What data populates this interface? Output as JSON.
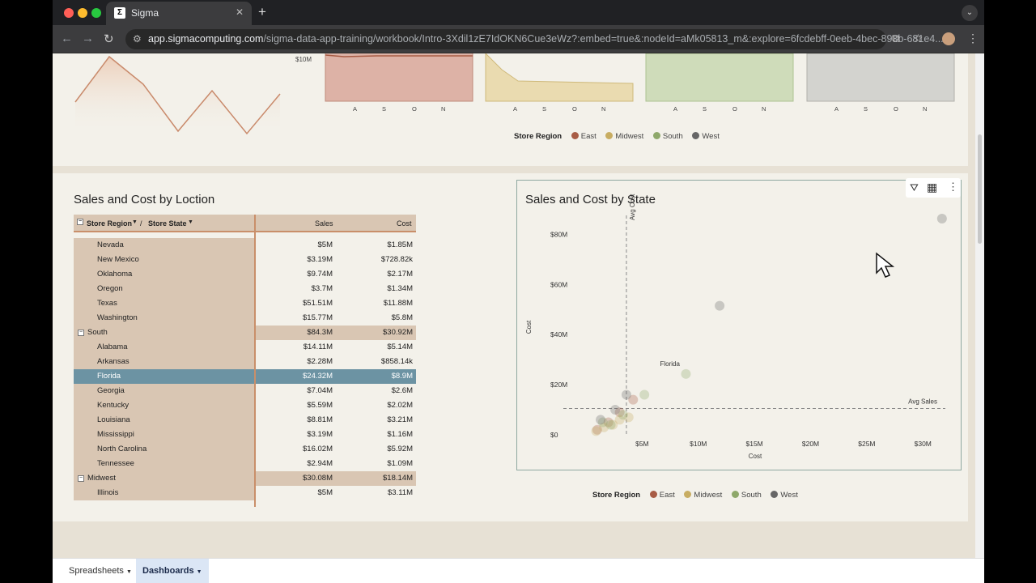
{
  "browser": {
    "tab_title": "Sigma",
    "tab_favicon": "sigma-logo",
    "url_host": "app.sigmacomputing.com",
    "url_path": "/sigma-data-app-training/workbook/Intro-3Xdil1zE7IdOKN6Cue3eWz?:embed=true&:nodeId=aMk05813_m&:explore=6fcdebff-0eeb-4bec-893b-681e4..."
  },
  "top_charts": {
    "axis_top_label": "$10M",
    "month_ticks": [
      "A",
      "S",
      "O",
      "N"
    ],
    "legend_title": "Store Region",
    "legend": [
      {
        "name": "East",
        "color": "#a85c45"
      },
      {
        "name": "Midwest",
        "color": "#c8ad62"
      },
      {
        "name": "South",
        "color": "#8ea86a"
      },
      {
        "name": "West",
        "color": "#666666"
      }
    ]
  },
  "table": {
    "title": "Sales and Cost by Loction",
    "head_region": "Store Region",
    "head_sep": "/",
    "head_state": "Store State",
    "head_sales": "Sales",
    "head_cost": "Cost",
    "rows": [
      {
        "label": "Nevada",
        "sales": "$5M",
        "cost": "$1.85M",
        "kind": "item"
      },
      {
        "label": "New Mexico",
        "sales": "$3.19M",
        "cost": "$728.82k",
        "kind": "item"
      },
      {
        "label": "Oklahoma",
        "sales": "$9.74M",
        "cost": "$2.17M",
        "kind": "item"
      },
      {
        "label": "Oregon",
        "sales": "$3.7M",
        "cost": "$1.34M",
        "kind": "item"
      },
      {
        "label": "Texas",
        "sales": "$51.51M",
        "cost": "$11.88M",
        "kind": "item"
      },
      {
        "label": "Washington",
        "sales": "$15.77M",
        "cost": "$5.8M",
        "kind": "item"
      },
      {
        "label": "South",
        "sales": "$84.3M",
        "cost": "$30.92M",
        "kind": "group"
      },
      {
        "label": "Alabama",
        "sales": "$14.11M",
        "cost": "$5.14M",
        "kind": "item"
      },
      {
        "label": "Arkansas",
        "sales": "$2.28M",
        "cost": "$858.14k",
        "kind": "item"
      },
      {
        "label": "Florida",
        "sales": "$24.32M",
        "cost": "$8.9M",
        "kind": "selected"
      },
      {
        "label": "Georgia",
        "sales": "$7.04M",
        "cost": "$2.6M",
        "kind": "item"
      },
      {
        "label": "Kentucky",
        "sales": "$5.59M",
        "cost": "$2.02M",
        "kind": "item"
      },
      {
        "label": "Louisiana",
        "sales": "$8.81M",
        "cost": "$3.21M",
        "kind": "item"
      },
      {
        "label": "Mississippi",
        "sales": "$3.19M",
        "cost": "$1.16M",
        "kind": "item"
      },
      {
        "label": "North Carolina",
        "sales": "$16.02M",
        "cost": "$5.92M",
        "kind": "item"
      },
      {
        "label": "Tennessee",
        "sales": "$2.94M",
        "cost": "$1.09M",
        "kind": "item"
      },
      {
        "label": "Midwest",
        "sales": "$30.08M",
        "cost": "$18.14M",
        "kind": "group"
      },
      {
        "label": "Illinois",
        "sales": "$5M",
        "cost": "$3.11M",
        "kind": "item"
      }
    ]
  },
  "scatter": {
    "title": "Sales and Cost by State",
    "xlabel": "Cost",
    "ylabel": "Cost",
    "avg_cost_label": "Avg Cost",
    "avg_sales_label": "Avg Sales",
    "highlight_label": "Florida",
    "legend_title": "Store Region"
  },
  "chart_data": {
    "type": "scatter",
    "title": "Sales and Cost by State",
    "xlabel": "Cost",
    "ylabel": "Cost",
    "x_ticks": [
      "$5M",
      "$10M",
      "$15M",
      "$20M",
      "$25M",
      "$30M"
    ],
    "y_ticks": [
      "$0",
      "$20M",
      "$40M",
      "$60M",
      "$80M"
    ],
    "xlim": [
      0,
      32
    ],
    "ylim": [
      0,
      85
    ],
    "avg_cost_x": 3.6,
    "avg_sales_y": 10.5,
    "series": [
      {
        "name": "East",
        "color": "#a85c45",
        "points": [
          [
            4.2,
            14
          ],
          [
            3.0,
            9
          ],
          [
            2.0,
            5
          ],
          [
            1.0,
            2
          ]
        ]
      },
      {
        "name": "Midwest",
        "color": "#c8ad62",
        "points": [
          [
            3.0,
            6
          ],
          [
            2.4,
            4
          ],
          [
            1.6,
            3
          ],
          [
            3.8,
            7
          ],
          [
            0.9,
            1.5
          ]
        ]
      },
      {
        "name": "South",
        "color": "#8ea86a",
        "points": [
          [
            8.9,
            24.3
          ],
          [
            5.2,
            16
          ],
          [
            2.2,
            4
          ],
          [
            1.5,
            5
          ],
          [
            3.3,
            8
          ]
        ]
      },
      {
        "name": "West",
        "color": "#666666",
        "points": [
          [
            31.7,
            89
          ],
          [
            11.9,
            51.5
          ],
          [
            3.6,
            16
          ],
          [
            2.6,
            10
          ],
          [
            1.3,
            6
          ]
        ]
      }
    ]
  },
  "bottom_tabs": {
    "tab1": "Spreadsheets",
    "tab2": "Dashboards"
  }
}
